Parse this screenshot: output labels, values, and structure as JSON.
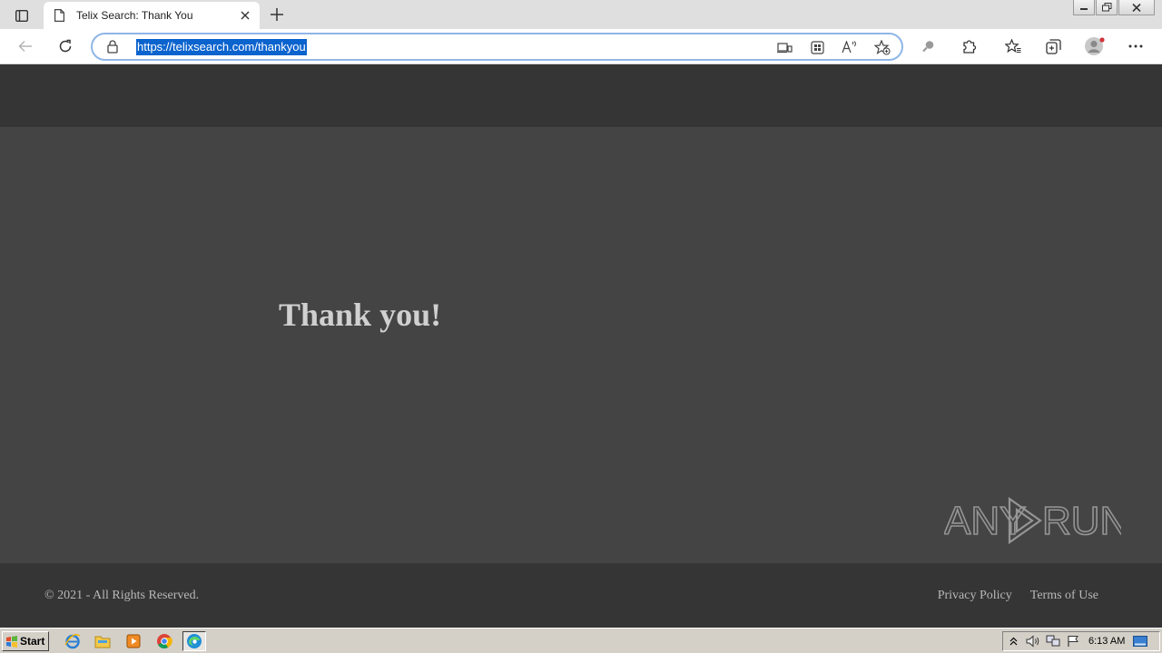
{
  "browser": {
    "tab": {
      "title": "Telix Search: Thank You"
    },
    "address": {
      "url": "https://telixsearch.com/thankyou"
    }
  },
  "page": {
    "heading": "Thank you!",
    "footer": {
      "copyright": "© 2021 - All Rights Reserved.",
      "links": [
        "Privacy Policy",
        "Terms of Use"
      ]
    },
    "watermark": "ANY RUN"
  },
  "taskbar": {
    "start_label": "Start",
    "clock": "6:13 AM"
  },
  "colors": {
    "header_bg": "#353535",
    "main_bg": "#444444",
    "heading_text": "#d0d0d0",
    "url_highlight": "#0b63ce",
    "omnibox_border": "#8fb6e8"
  }
}
